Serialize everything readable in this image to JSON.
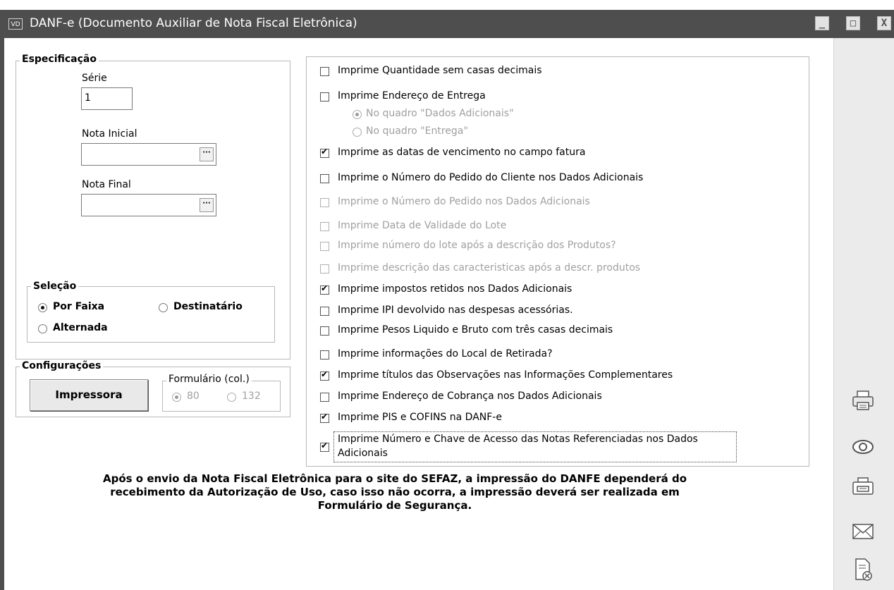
{
  "window": {
    "app_icon_text": "VD",
    "title": "DANF-e (Documento Auxiliar de Nota Fiscal Eletrônica)",
    "minimize": "_",
    "maximize": "□",
    "close": "X"
  },
  "especificacao": {
    "legend": "Especificação",
    "serie_label": "Série",
    "serie_value": "1",
    "nota_inicial_label": "Nota Inicial",
    "nota_inicial_value": "",
    "nota_final_label": "Nota Final",
    "nota_final_value": "",
    "lookup_glyph": "···"
  },
  "selecao": {
    "legend": "Seleção",
    "por_faixa": "Por Faixa",
    "destinatario": "Destinatário",
    "alternada": "Alternada",
    "selected": "Por Faixa"
  },
  "configuracoes": {
    "legend": "Configurações",
    "impressora_button": "Impressora",
    "formulario_legend": "Formulário (col.)",
    "opt_80": "80",
    "opt_132": "132",
    "selected": "80"
  },
  "options": [
    {
      "label": "Imprime Quantidade sem casas decimais",
      "checked": false,
      "enabled": true
    },
    {
      "label": "Imprime Endereço de Entrega",
      "checked": false,
      "enabled": true
    },
    {
      "label": "Imprime as datas de vencimento no campo fatura",
      "checked": true,
      "enabled": true
    },
    {
      "label": "Imprime o Número do Pedido do Cliente nos Dados Adicionais",
      "checked": false,
      "enabled": true
    },
    {
      "label": "Imprime o Número do Pedido nos Dados Adicionais",
      "checked": false,
      "enabled": false
    },
    {
      "label": "Imprime Data de Validade do Lote",
      "checked": false,
      "enabled": false
    },
    {
      "label": "Imprime número do lote após a descrição dos Produtos?",
      "checked": false,
      "enabled": false
    },
    {
      "label": "Imprime descrição das caracteristicas após a descr. produtos",
      "checked": false,
      "enabled": false
    },
    {
      "label": "Imprime impostos retidos nos Dados Adicionais",
      "checked": true,
      "enabled": true
    },
    {
      "label": "Imprime IPI devolvido nas despesas acessórias.",
      "checked": false,
      "enabled": true
    },
    {
      "label": "Imprime Pesos Liquido e Bruto com três casas decimais",
      "checked": false,
      "enabled": true
    },
    {
      "label": "Imprime informações do Local de Retirada?",
      "checked": false,
      "enabled": true
    },
    {
      "label": "Imprime títulos das Observações nas Informações Complementares",
      "checked": true,
      "enabled": true
    },
    {
      "label": "Imprime Endereço de Cobrança nos Dados Adicionais",
      "checked": false,
      "enabled": true
    },
    {
      "label": "Imprime PIS e COFINS na DANF-e",
      "checked": true,
      "enabled": true
    },
    {
      "label_line1": "Imprime Número e Chave de Acesso das Notas Referenciadas nos Dados",
      "label_line2": "Adicionais",
      "checked": true,
      "enabled": true
    }
  ],
  "entrega_options": {
    "dados_adicionais": "No quadro \"Dados Adicionais\"",
    "entrega": "No quadro \"Entrega\"",
    "selected": "No quadro \"Dados Adicionais\""
  },
  "notice": {
    "line1": "Após o envio da Nota Fiscal Eletrônica para o site do SEFAZ, a impressão do DANFE dependerá do",
    "line2": "recebimento da Autorização de Uso, caso isso não ocorra, a impressão deverá ser realizada em",
    "line3": "Formulário de Segurança."
  },
  "side_icons": [
    "printer-icon",
    "eye-icon",
    "printer-tray-icon",
    "envelope-icon",
    "document-cancel-icon"
  ]
}
